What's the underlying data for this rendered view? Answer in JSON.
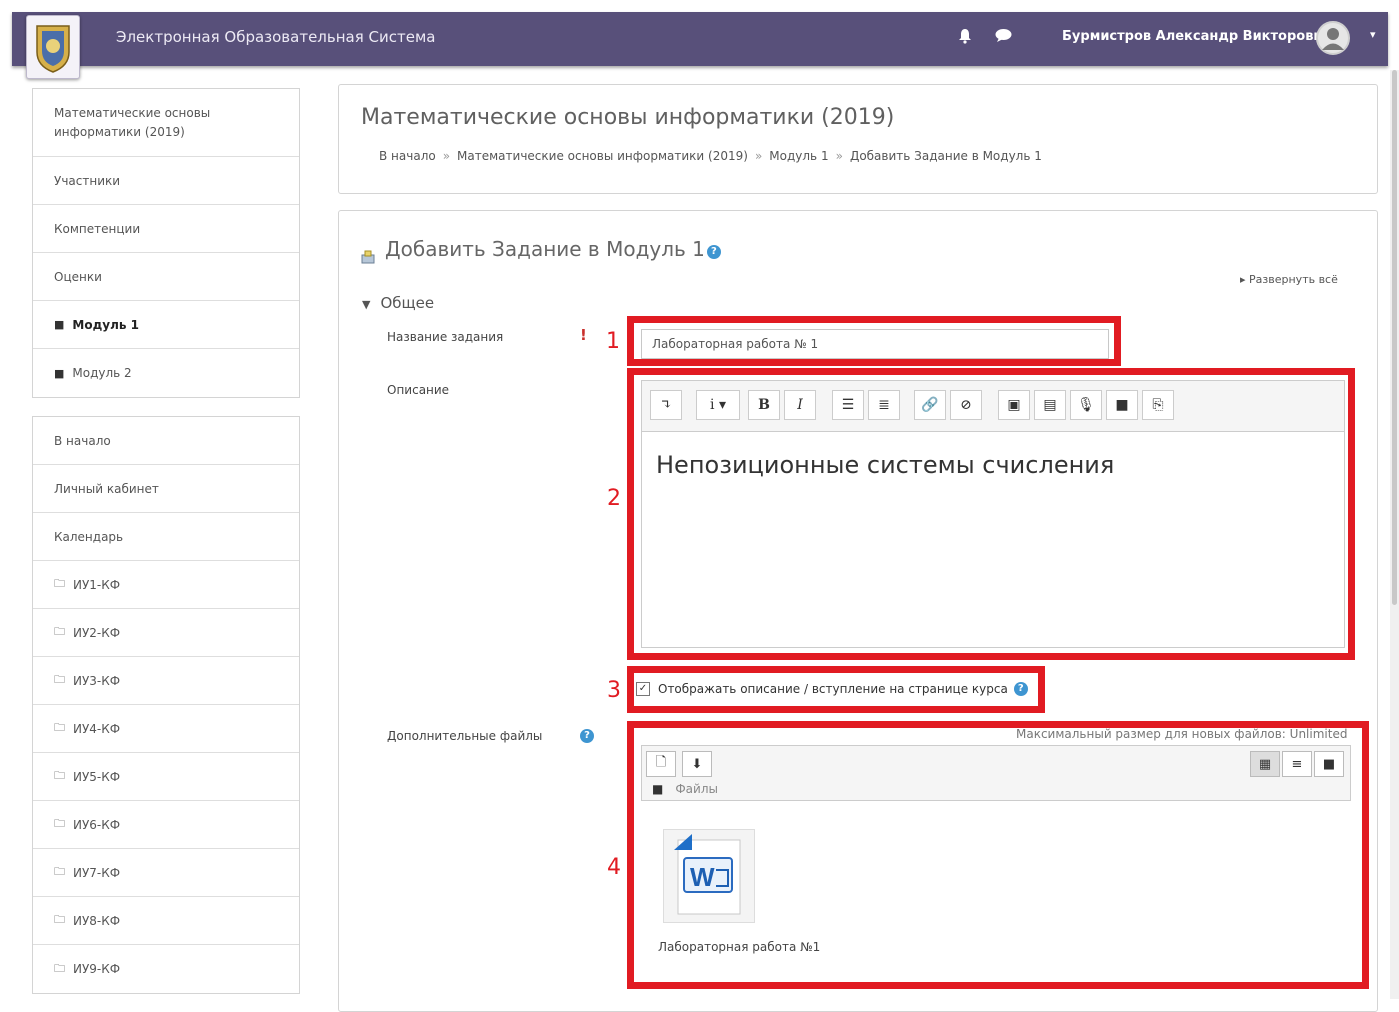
{
  "navbar": {
    "site_title": "Электронная Образовательная Система",
    "user_name": "Бурмистров Александр Викторович"
  },
  "sidebar_course": [
    {
      "label": "Математические основы информатики (2019)",
      "icon": ""
    },
    {
      "label": "Участники",
      "icon": ""
    },
    {
      "label": "Компетенции",
      "icon": ""
    },
    {
      "label": "Оценки",
      "icon": ""
    },
    {
      "label": "Модуль 1",
      "icon": "section-icon",
      "active": true
    },
    {
      "label": "Модуль 2",
      "icon": "section-icon"
    }
  ],
  "sidebar_nav": [
    {
      "label": "В начало",
      "icon": ""
    },
    {
      "label": "Личный кабинет",
      "icon": ""
    },
    {
      "label": "Календарь",
      "icon": ""
    },
    {
      "label": "ИУ1-КФ",
      "icon": "folder-icon"
    },
    {
      "label": "ИУ2-КФ",
      "icon": "folder-icon"
    },
    {
      "label": "ИУ3-КФ",
      "icon": "folder-icon"
    },
    {
      "label": "ИУ4-КФ",
      "icon": "folder-icon"
    },
    {
      "label": "ИУ5-КФ",
      "icon": "folder-icon"
    },
    {
      "label": "ИУ6-КФ",
      "icon": "folder-icon"
    },
    {
      "label": "ИУ7-КФ",
      "icon": "folder-icon"
    },
    {
      "label": "ИУ8-КФ",
      "icon": "folder-icon"
    },
    {
      "label": "ИУ9-КФ",
      "icon": "folder-icon"
    }
  ],
  "header": {
    "course_title": "Математические основы информатики (2019)",
    "breadcrumb": [
      "В начало",
      "Математические основы информатики (2019)",
      "Модуль 1",
      "Добавить Задание в Модуль 1"
    ]
  },
  "form": {
    "heading": "Добавить Задание в Модуль 1",
    "expand_all": "Развернуть всё",
    "section_general": "Общее",
    "name_label": "Название задания",
    "name_value": "Лабораторная работа № 1",
    "description_label": "Описание",
    "description_text": "Непозиционные системы счисления",
    "show_description_label": "Отображать описание / вступление на странице курса",
    "show_description_checked": true,
    "files_label": "Дополнительные файлы",
    "max_size_text": "Максимальный размер для новых файлов: Unlimited",
    "files_folder": "Файлы",
    "file_name": "Лабораторная работа №1"
  },
  "annotations": [
    "1",
    "2",
    "3",
    "4"
  ],
  "colors": {
    "navbar": "#58507a",
    "annotation": "#e11b22",
    "help": "#3e95d1"
  }
}
